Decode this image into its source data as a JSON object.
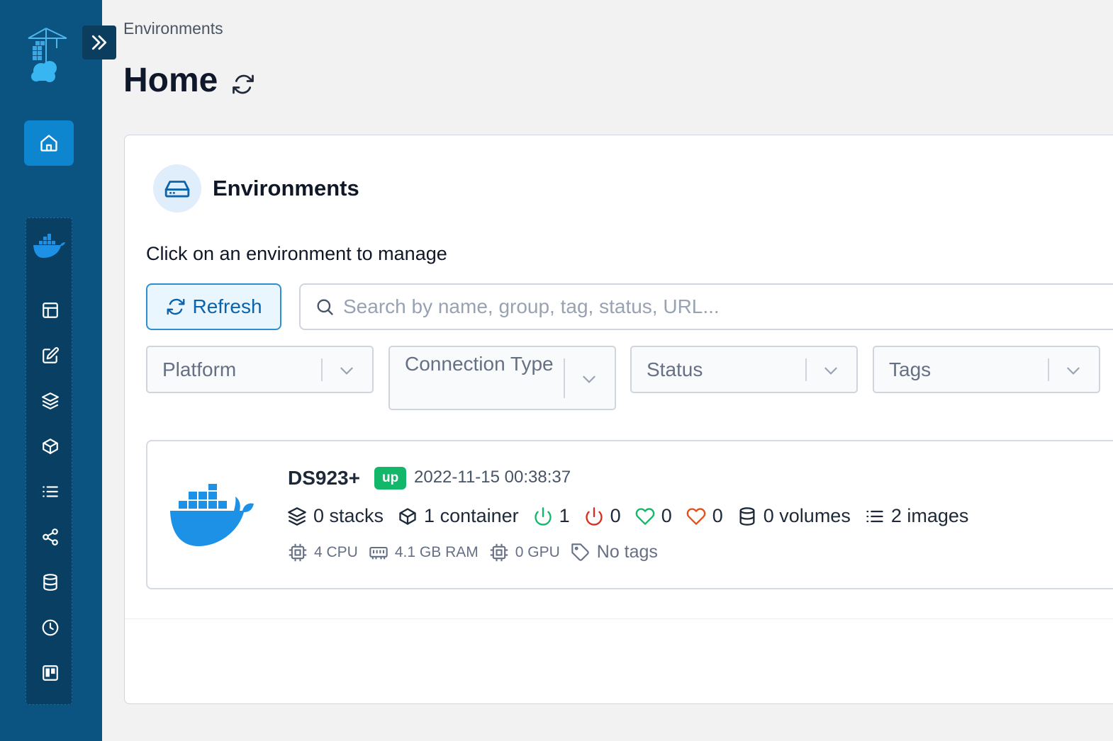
{
  "breadcrumb": "Environments",
  "page": {
    "title": "Home"
  },
  "environments_card": {
    "title": "Environments",
    "subtitle": "Click on an environment to manage",
    "refresh_label": "Refresh",
    "search_placeholder": "Search by name, group, tag, status, URL...",
    "filters": [
      {
        "label": "Platform"
      },
      {
        "label": "Connection Type"
      },
      {
        "label": "Status"
      },
      {
        "label": "Tags"
      }
    ]
  },
  "environment": {
    "name": "DS923+",
    "status": "up",
    "timestamp": "2022-11-15 00:38:37",
    "stacks": "0 stacks",
    "containers": "1 container",
    "running": "1",
    "stopped": "0",
    "healthy": "0",
    "unhealthy": "0",
    "volumes": "0 volumes",
    "images": "2 images",
    "cpu": "4 CPU",
    "ram": "4.1 GB RAM",
    "gpu": "0 GPU",
    "tags": "No tags"
  },
  "sidebar": {
    "items": [
      {
        "icon": "home-icon"
      },
      {
        "icon": "dashboard-icon"
      },
      {
        "icon": "edit-icon"
      },
      {
        "icon": "layers-icon"
      },
      {
        "icon": "box-icon"
      },
      {
        "icon": "list-icon"
      },
      {
        "icon": "share-icon"
      },
      {
        "icon": "database-icon"
      },
      {
        "icon": "clock-icon"
      },
      {
        "icon": "board-icon"
      }
    ]
  },
  "colors": {
    "sidebar_bg": "#0b5380",
    "accent": "#0d85cf",
    "status_up": "#12b76a",
    "running": "#12b76a",
    "stopped": "#d92d20",
    "healthy": "#12b76a",
    "unhealthy": "#e2511a",
    "docker_blue": "#1d91e6"
  }
}
